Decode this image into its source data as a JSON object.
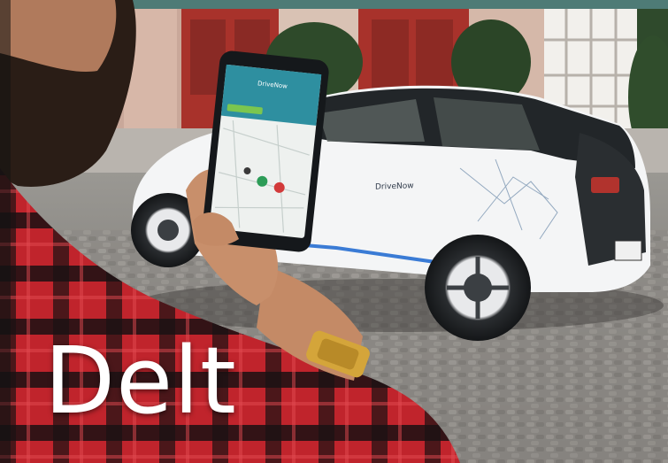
{
  "caption": {
    "text": "Delt"
  },
  "phone_app": {
    "brand": "DriveNow"
  },
  "car": {
    "brand": "DriveNow"
  },
  "colors": {
    "caption_text": "#ffffff",
    "car_body": "#f4f5f6",
    "car_dark": "#222629",
    "accent_blue": "#3a7bd5",
    "app_teal": "#2e8fa0",
    "building_red": "#a8322b",
    "shirt_red": "#c0242c",
    "watch_gold": "#d4a53a",
    "cobblestone": "#8d8a86"
  },
  "icons": [
    "phone",
    "car",
    "map-pin",
    "wristwatch"
  ]
}
